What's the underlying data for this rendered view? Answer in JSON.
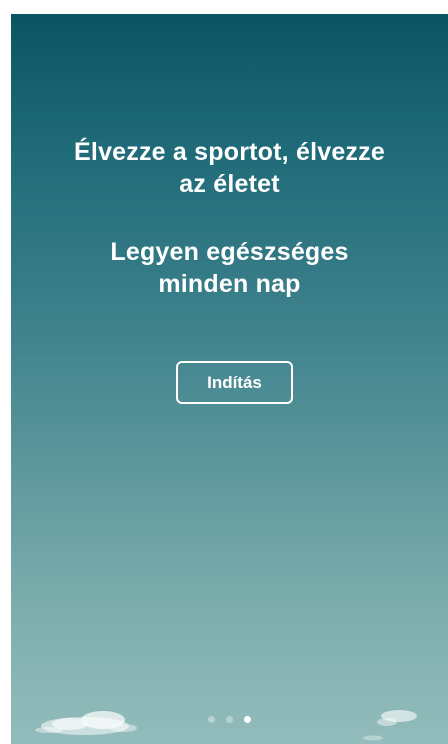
{
  "onboarding": {
    "headline_line1": "Élvezze a sportot, élvezze",
    "headline_line2": "az életet",
    "subline_line1": "Legyen egészséges",
    "subline_line2": "minden nap",
    "start_button_label": "Indítás"
  },
  "pager": {
    "total_pages": 3,
    "current_page": 3
  },
  "colors": {
    "gradient_top": "#0b5563",
    "gradient_bottom": "#93bcbc",
    "text": "#ffffff"
  }
}
